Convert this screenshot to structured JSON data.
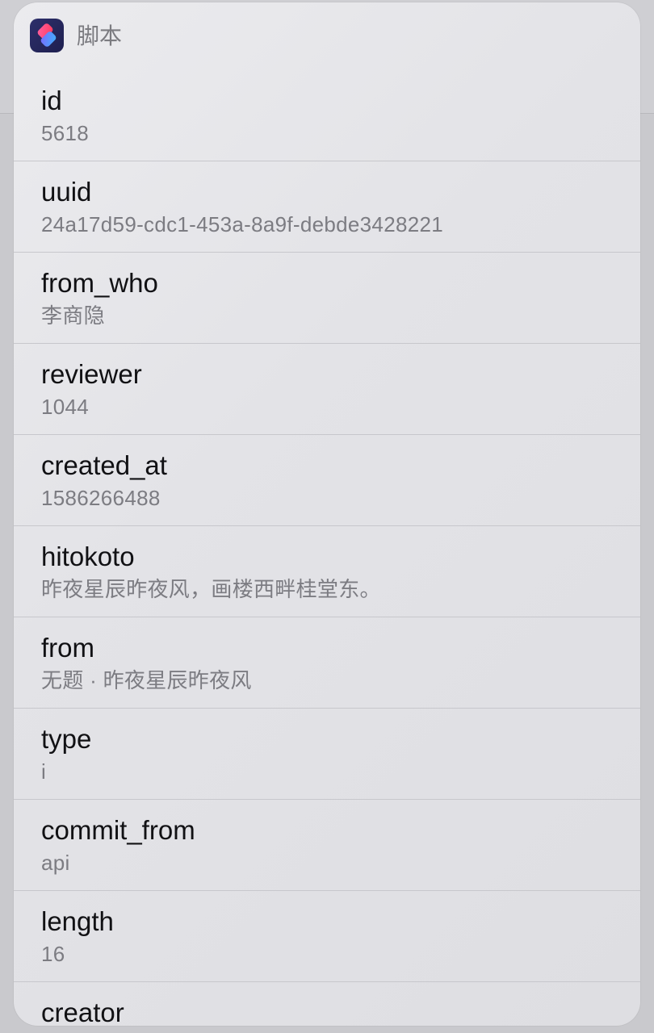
{
  "app": {
    "title": "脚本",
    "icon": "shortcuts-app-icon"
  },
  "rows": [
    {
      "key": "id",
      "value": "5618"
    },
    {
      "key": "uuid",
      "value": "24a17d59-cdc1-453a-8a9f-debde3428221"
    },
    {
      "key": "from_who",
      "value": "李商隐"
    },
    {
      "key": "reviewer",
      "value": "1044"
    },
    {
      "key": "created_at",
      "value": "1586266488"
    },
    {
      "key": "hitokoto",
      "value": "昨夜星辰昨夜风，画楼西畔桂堂东。"
    },
    {
      "key": "from",
      "value": "无题 · 昨夜星辰昨夜风"
    },
    {
      "key": "type",
      "value": "i"
    },
    {
      "key": "commit_from",
      "value": "api"
    },
    {
      "key": "length",
      "value": "16"
    },
    {
      "key": "creator",
      "value": ""
    }
  ],
  "colors": {
    "key_text": "#111114",
    "value_text": "#7c7c82",
    "separator": "#c7c7cc"
  }
}
